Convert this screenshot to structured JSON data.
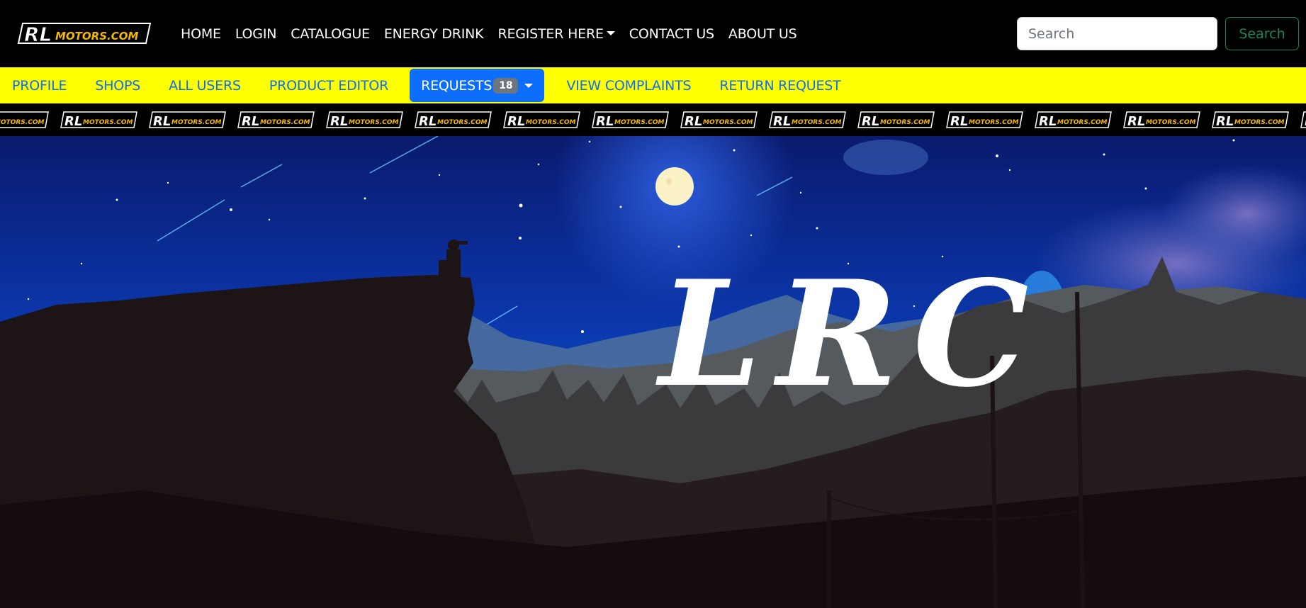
{
  "brand": {
    "logo_text": "RLMOTORS.COM",
    "logo_icon": "rl-motors-logo",
    "colors": {
      "logo_yellow": "#f5b800",
      "navbar_bg": "#000000",
      "adminbar_bg": "#ffff00",
      "link_blue": "#0d6efd",
      "search_green": "#198754"
    }
  },
  "nav": {
    "items": [
      {
        "label": "HOME"
      },
      {
        "label": "LOGIN"
      },
      {
        "label": "CATALOGUE"
      },
      {
        "label": "ENERGY DRINK"
      },
      {
        "label": "REGISTER HERE",
        "dropdown": true
      },
      {
        "label": "CONTACT US"
      },
      {
        "label": "ABOUT US"
      }
    ]
  },
  "search": {
    "placeholder": "Search",
    "value": "",
    "button_label": "Search"
  },
  "adminbar": {
    "items": [
      {
        "label": "PROFILE"
      },
      {
        "label": "SHOPS"
      },
      {
        "label": "ALL USERS"
      },
      {
        "label": "PRODUCT EDITOR"
      },
      {
        "label": "REQUESTS",
        "badge": "18",
        "dropdown": true,
        "active": true
      },
      {
        "label": "VIEW COMPLAINTS"
      },
      {
        "label": "RETURN REQUEST"
      }
    ]
  },
  "strip": {
    "logo_text": "RLMOTORS.COM",
    "repeat_icon": "rl-motors-logo"
  },
  "hero": {
    "title": "LRC"
  }
}
